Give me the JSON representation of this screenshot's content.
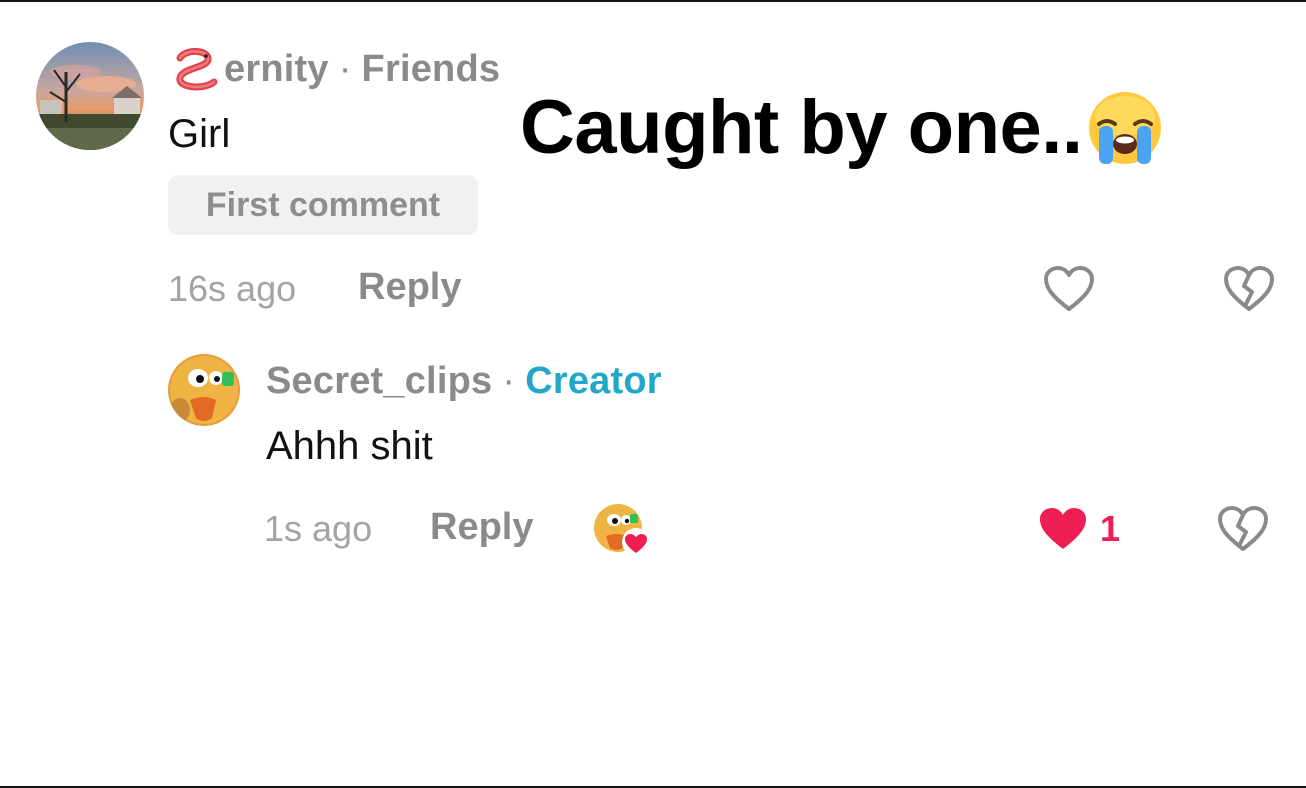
{
  "overlay_caption": "Caught by one..",
  "comments": [
    {
      "username": "ernity",
      "relation": "Friends",
      "text": "Girl",
      "badge": "First comment",
      "time": "16s ago",
      "reply_label": "Reply",
      "liked": false
    },
    {
      "username": "Secret_clips",
      "relation": "Creator",
      "text": "Ahhh shit",
      "time": "1s ago",
      "reply_label": "Reply",
      "liked": true,
      "like_count": "1",
      "liked_by_creator": true
    }
  ],
  "colors": {
    "like_red": "#ee1d52",
    "creator_blue": "#20a7c9",
    "meta_gray": "#8a8a8a"
  }
}
